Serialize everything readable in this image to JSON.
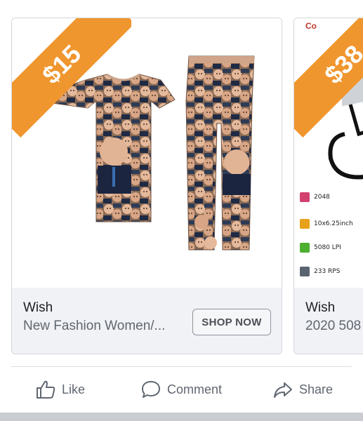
{
  "cards": [
    {
      "price": "$15",
      "seller": "Wish",
      "description": "New Fashion Women/...",
      "button": "SHOP NOW",
      "product_image": "putin-collage-tshirt-and-joggers",
      "accent_color": "#f0962e"
    },
    {
      "price": "$38",
      "corner_text": "Co",
      "seller": "Wish",
      "description": "2020 508",
      "product_image": "tablet-device-specs",
      "specs": [
        {
          "icon": "pen-icon",
          "text": "2048"
        },
        {
          "icon": "area-icon",
          "text": "10x6.25inch"
        },
        {
          "icon": "chip-icon",
          "text": "5080 LPI"
        },
        {
          "icon": "speed-icon",
          "text": "233 RPS"
        }
      ],
      "accent_color": "#f0962e"
    }
  ],
  "actions": {
    "like": "Like",
    "comment": "Comment",
    "share": "Share"
  }
}
